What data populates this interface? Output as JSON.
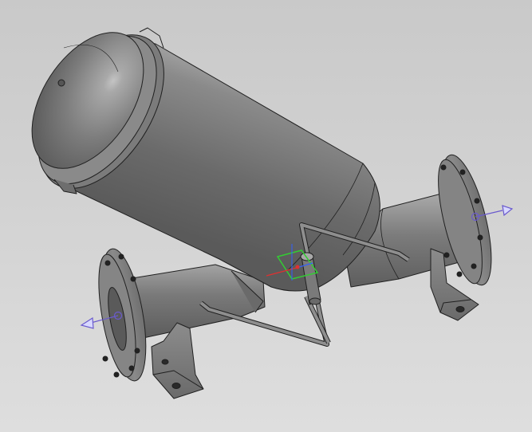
{
  "app": {
    "view": "3d-model-viewport",
    "background_color": "#d3d3d3",
    "model_color": "#7a7a7a"
  },
  "model": {
    "part": "filter-housing-assembly",
    "components": [
      "vessel-body",
      "vessel-dome-cap",
      "top-flange",
      "inlet-pipe",
      "outlet-pipe",
      "inlet-flange",
      "outlet-flange",
      "support-bracket-left",
      "support-bracket-right",
      "bypass-tube",
      "drain-valve"
    ]
  },
  "overlays": {
    "flow_axis_color": "#6a5acd",
    "frame_color": "#33cc33",
    "triad_x_color": "#e03030",
    "triad_y_color": "#3060ff",
    "icons": [
      "port-axis-arrow-icon",
      "coordinate-frame-icon"
    ]
  }
}
